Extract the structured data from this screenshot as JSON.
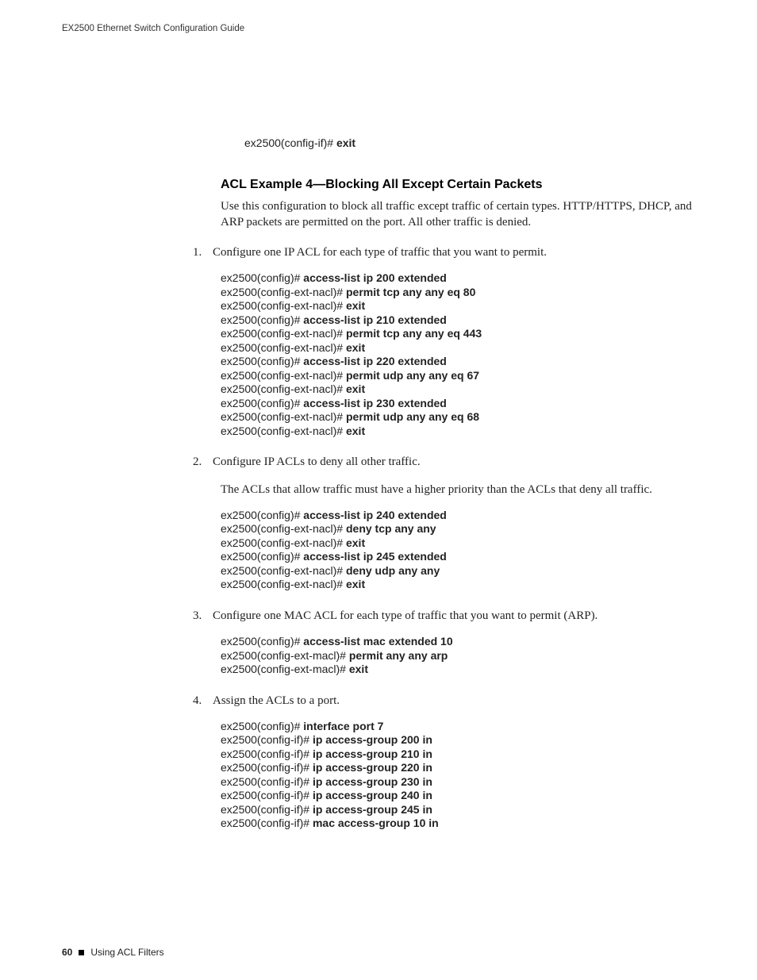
{
  "header": {
    "running_title": "EX2500 Ethernet Switch Configuration Guide"
  },
  "intro_code": {
    "lines": [
      {
        "prompt": "ex2500(config-if)# ",
        "cmd": "exit"
      }
    ]
  },
  "section": {
    "heading": "ACL Example 4—Blocking All Except Certain Packets",
    "intro": "Use this configuration to block all traffic except traffic of certain types. HTTP/HTTPS, DHCP, and ARP packets are permitted on the port. All other traffic is denied."
  },
  "steps": [
    {
      "text": "Configure one IP ACL for each type of traffic that you want to permit.",
      "code": [
        {
          "prompt": "ex2500(config)# ",
          "cmd": "access-list ip 200 extended"
        },
        {
          "prompt": "ex2500(config-ext-nacl)# ",
          "cmd": "permit tcp any any eq 80"
        },
        {
          "prompt": "ex2500(config-ext-nacl)# ",
          "cmd": "exit"
        },
        {
          "prompt": "ex2500(config)# ",
          "cmd": "access-list ip 210 extended"
        },
        {
          "prompt": "ex2500(config-ext-nacl)# ",
          "cmd": "permit tcp any any eq 443"
        },
        {
          "prompt": "ex2500(config-ext-nacl)# ",
          "cmd": "exit"
        },
        {
          "prompt": "ex2500(config)# ",
          "cmd": "access-list ip 220 extended"
        },
        {
          "prompt": "ex2500(config-ext-nacl)# ",
          "cmd": "permit udp any any eq 67"
        },
        {
          "prompt": "ex2500(config-ext-nacl)# ",
          "cmd": "exit"
        },
        {
          "prompt": "ex2500(config)# ",
          "cmd": "access-list ip 230 extended"
        },
        {
          "prompt": "ex2500(config-ext-nacl)# ",
          "cmd": "permit udp any any eq 68"
        },
        {
          "prompt": "ex2500(config-ext-nacl)# ",
          "cmd": "exit"
        }
      ]
    },
    {
      "text": "Configure IP ACLs to deny all other traffic.",
      "note": "The ACLs that allow traffic must have a higher priority than the ACLs that deny all traffic.",
      "code": [
        {
          "prompt": "ex2500(config)# ",
          "cmd": "access-list ip 240 extended"
        },
        {
          "prompt": "ex2500(config-ext-nacl)# ",
          "cmd": "deny tcp any any"
        },
        {
          "prompt": "ex2500(config-ext-nacl)# ",
          "cmd": "exit"
        },
        {
          "prompt": "ex2500(config)# ",
          "cmd": "access-list ip 245 extended"
        },
        {
          "prompt": "ex2500(config-ext-nacl)# ",
          "cmd": "deny udp any any"
        },
        {
          "prompt": "ex2500(config-ext-nacl)# ",
          "cmd": "exit"
        }
      ]
    },
    {
      "text": "Configure one MAC ACL for each type of traffic that you want to permit (ARP).",
      "code": [
        {
          "prompt": "ex2500(config)# ",
          "cmd": "access-list mac extended 10"
        },
        {
          "prompt": "ex2500(config-ext-macl)# ",
          "cmd": "permit any any arp"
        },
        {
          "prompt": "ex2500(config-ext-macl)# ",
          "cmd": "exit"
        }
      ]
    },
    {
      "text": "Assign the ACLs to a port.",
      "code": [
        {
          "prompt": "ex2500(config)# ",
          "cmd": "interface port 7"
        },
        {
          "prompt": "ex2500(config-if)# ",
          "cmd": "ip access-group 200 in"
        },
        {
          "prompt": "ex2500(config-if)# ",
          "cmd": "ip access-group 210 in"
        },
        {
          "prompt": "ex2500(config-if)# ",
          "cmd": "ip access-group 220 in"
        },
        {
          "prompt": "ex2500(config-if)# ",
          "cmd": "ip access-group 230 in"
        },
        {
          "prompt": "ex2500(config-if)# ",
          "cmd": "ip access-group 240 in"
        },
        {
          "prompt": "ex2500(config-if)# ",
          "cmd": "ip access-group 245 in"
        },
        {
          "prompt": "ex2500(config-if)# ",
          "cmd": "mac access-group 10 in"
        }
      ]
    }
  ],
  "footer": {
    "page_number": "60",
    "section_title": "Using ACL Filters"
  }
}
